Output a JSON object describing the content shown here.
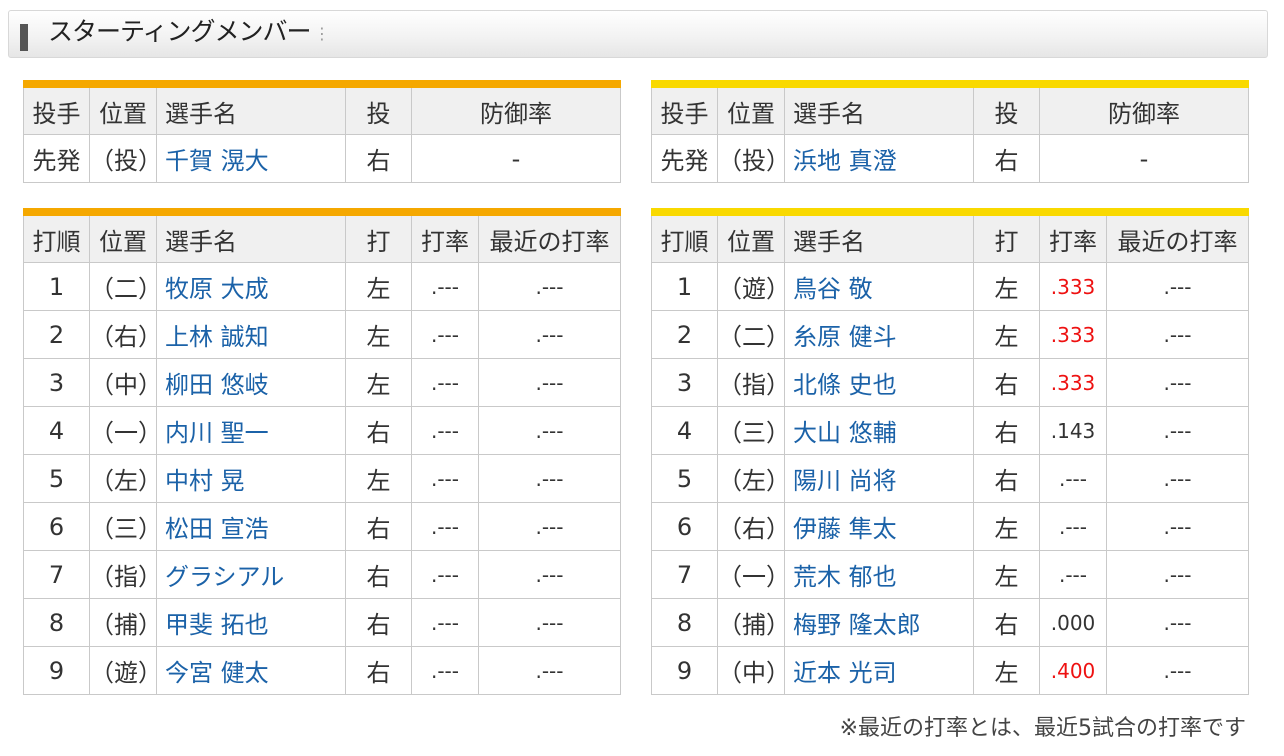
{
  "section_title": "スターティングメンバー",
  "colors": {
    "home_accent": "#f5a800",
    "away_accent": "#f9d900",
    "hot_avg": "#e11111",
    "player_link": "#1b62a8"
  },
  "home": {
    "pitcher_header": [
      "投手",
      "位置",
      "選手名",
      "投",
      "防御率"
    ],
    "pitcher": {
      "role": "先発",
      "pos": "（投）",
      "name": "千賀 滉大",
      "throws": "右",
      "era": "-"
    },
    "batting_header": [
      "打順",
      "位置",
      "選手名",
      "打",
      "打率",
      "最近の打率"
    ],
    "batters": [
      {
        "order": "1",
        "pos": "（二）",
        "name": "牧原 大成",
        "bats": "左",
        "avg": ".---",
        "recent": ".---",
        "hot": false
      },
      {
        "order": "2",
        "pos": "（右）",
        "name": "上林 誠知",
        "bats": "左",
        "avg": ".---",
        "recent": ".---",
        "hot": false
      },
      {
        "order": "3",
        "pos": "（中）",
        "name": "柳田 悠岐",
        "bats": "左",
        "avg": ".---",
        "recent": ".---",
        "hot": false
      },
      {
        "order": "4",
        "pos": "（一）",
        "name": "内川 聖一",
        "bats": "右",
        "avg": ".---",
        "recent": ".---",
        "hot": false
      },
      {
        "order": "5",
        "pos": "（左）",
        "name": "中村 晃",
        "bats": "左",
        "avg": ".---",
        "recent": ".---",
        "hot": false
      },
      {
        "order": "6",
        "pos": "（三）",
        "name": "松田 宣浩",
        "bats": "右",
        "avg": ".---",
        "recent": ".---",
        "hot": false
      },
      {
        "order": "7",
        "pos": "（指）",
        "name": "グラシアル",
        "bats": "右",
        "avg": ".---",
        "recent": ".---",
        "hot": false
      },
      {
        "order": "8",
        "pos": "（捕）",
        "name": "甲斐 拓也",
        "bats": "右",
        "avg": ".---",
        "recent": ".---",
        "hot": false
      },
      {
        "order": "9",
        "pos": "（遊）",
        "name": "今宮 健太",
        "bats": "右",
        "avg": ".---",
        "recent": ".---",
        "hot": false
      }
    ]
  },
  "away": {
    "pitcher_header": [
      "投手",
      "位置",
      "選手名",
      "投",
      "防御率"
    ],
    "pitcher": {
      "role": "先発",
      "pos": "（投）",
      "name": "浜地 真澄",
      "throws": "右",
      "era": "-"
    },
    "batting_header": [
      "打順",
      "位置",
      "選手名",
      "打",
      "打率",
      "最近の打率"
    ],
    "batters": [
      {
        "order": "1",
        "pos": "（遊）",
        "name": "鳥谷 敬",
        "bats": "左",
        "avg": ".333",
        "recent": ".---",
        "hot": true
      },
      {
        "order": "2",
        "pos": "（二）",
        "name": "糸原 健斗",
        "bats": "左",
        "avg": ".333",
        "recent": ".---",
        "hot": true
      },
      {
        "order": "3",
        "pos": "（指）",
        "name": "北條 史也",
        "bats": "右",
        "avg": ".333",
        "recent": ".---",
        "hot": true
      },
      {
        "order": "4",
        "pos": "（三）",
        "name": "大山 悠輔",
        "bats": "右",
        "avg": ".143",
        "recent": ".---",
        "hot": false
      },
      {
        "order": "5",
        "pos": "（左）",
        "name": "陽川 尚将",
        "bats": "右",
        "avg": ".---",
        "recent": ".---",
        "hot": false
      },
      {
        "order": "6",
        "pos": "（右）",
        "name": "伊藤 隼太",
        "bats": "左",
        "avg": ".---",
        "recent": ".---",
        "hot": false
      },
      {
        "order": "7",
        "pos": "（一）",
        "name": "荒木 郁也",
        "bats": "左",
        "avg": ".---",
        "recent": ".---",
        "hot": false
      },
      {
        "order": "8",
        "pos": "（捕）",
        "name": "梅野 隆太郎",
        "bats": "右",
        "avg": ".000",
        "recent": ".---",
        "hot": false
      },
      {
        "order": "9",
        "pos": "（中）",
        "name": "近本 光司",
        "bats": "左",
        "avg": ".400",
        "recent": ".---",
        "hot": true
      }
    ]
  },
  "footnote": "※最近の打率とは、最近5試合の打率です"
}
